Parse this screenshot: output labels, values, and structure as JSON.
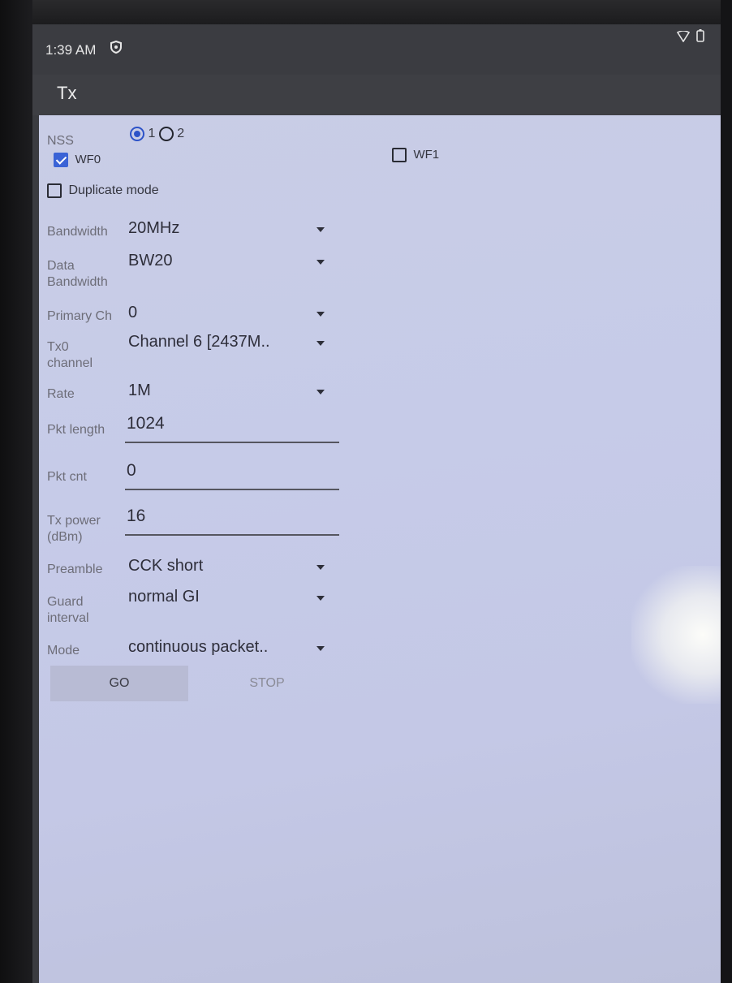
{
  "status_bar": {
    "time": "1:39 AM"
  },
  "toolbar": {
    "title": "Tx"
  },
  "nss": {
    "label": "NSS",
    "options": [
      "1",
      "2"
    ],
    "selected": "1"
  },
  "wf0": {
    "label": "WF0",
    "checked": true
  },
  "wf1": {
    "label": "WF1",
    "checked": false
  },
  "duplicate_mode": {
    "label": "Duplicate mode",
    "checked": false
  },
  "fields": {
    "bandwidth": {
      "label": "Bandwidth",
      "value": "20MHz"
    },
    "data_bandwidth": {
      "label_line1": "Data",
      "label_line2": "Bandwidth",
      "value": "BW20"
    },
    "primary_ch": {
      "label": "Primary Ch",
      "value": "0"
    },
    "tx0_channel": {
      "label_line1": "Tx0",
      "label_line2": "channel",
      "value": "Channel 6 [2437M.."
    },
    "rate": {
      "label": "Rate",
      "value": "1M"
    },
    "pkt_length": {
      "label": "Pkt length",
      "value": "1024"
    },
    "pkt_cnt": {
      "label": "Pkt cnt",
      "value": "0"
    },
    "tx_power": {
      "label_line1": "Tx power",
      "label_line2": "(dBm)",
      "value": "16"
    },
    "preamble": {
      "label": "Preamble",
      "value": "CCK short"
    },
    "guard_interval": {
      "label_line1": "Guard",
      "label_line2": "interval",
      "value": "normal GI"
    },
    "mode": {
      "label": "Mode",
      "value": "continuous packet.."
    }
  },
  "buttons": {
    "go": "GO",
    "stop": "STOP"
  },
  "icons": {
    "status_left": "shield-icon",
    "status_right": [
      "wifi-icon",
      "battery-icon"
    ],
    "dropdown": "caret-down-icon"
  }
}
